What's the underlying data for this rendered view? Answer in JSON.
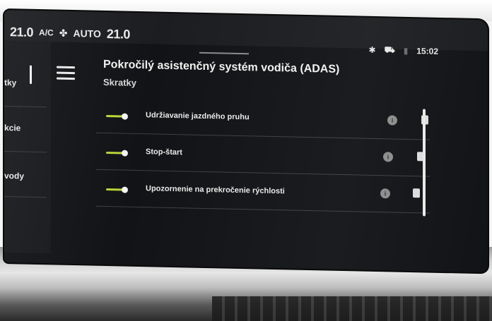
{
  "climate": {
    "temp_left": "21.0",
    "ac_label": "A/C",
    "fan_label": "AUTO",
    "temp_right": "21.0"
  },
  "status": {
    "time": "15:02"
  },
  "leftnav": {
    "items": [
      {
        "label": "tky"
      },
      {
        "label": "kcie"
      },
      {
        "label": "vody"
      }
    ]
  },
  "header": {
    "title": "Pokročilý asistenčný systém vodiča (ADAS)",
    "subtitle": "Skratky"
  },
  "list": {
    "rows": [
      {
        "label": "Udržiavanie jazdného pruhu",
        "enabled": true
      },
      {
        "label": "Stop-štart",
        "enabled": true
      },
      {
        "label": "Upozornenie na prekročenie rýchlosti",
        "enabled": true
      }
    ]
  },
  "colors": {
    "toggle_on": "#b8d43a",
    "screen_bg": "#121316"
  },
  "icons": {
    "menu": "hamburger-icon",
    "fan": "fan-icon",
    "bluetooth": "bluetooth-icon",
    "car": "car-icon",
    "info": "info-icon",
    "shortcut": "shortcut-icon"
  }
}
